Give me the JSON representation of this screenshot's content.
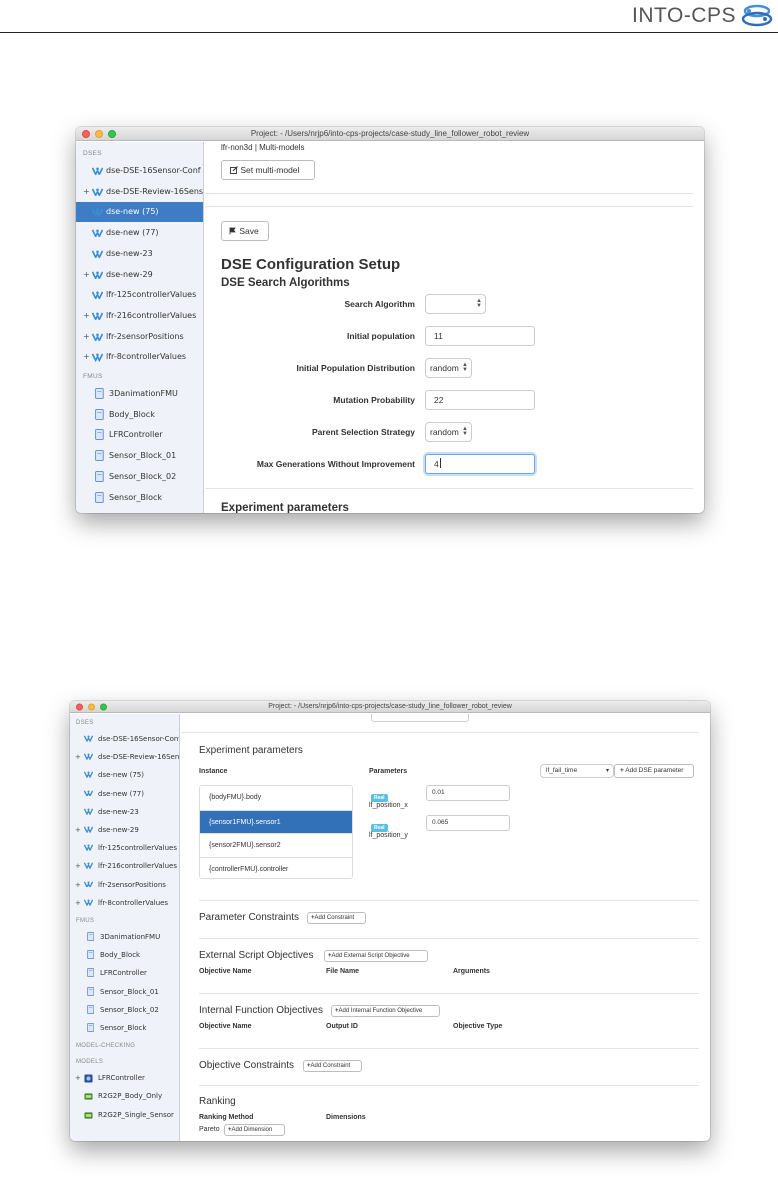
{
  "header": {
    "brand": "INTO-CPS"
  },
  "window1": {
    "title": "Project: - /Users/nrjp6/into-cps-projects/case-study_line_follower_robot_review",
    "sidebar": {
      "dses_label": "DSES",
      "dses": [
        {
          "label": "dse-DSE-16Sensor-Conf",
          "expand": ""
        },
        {
          "label": "dse-DSE-Review-16Sens",
          "expand": "+"
        },
        {
          "label": "dse-new (75)",
          "expand": "",
          "selected": true
        },
        {
          "label": "dse-new (77)",
          "expand": ""
        },
        {
          "label": "dse-new-23",
          "expand": ""
        },
        {
          "label": "dse-new-29",
          "expand": "+"
        },
        {
          "label": "lfr-125controllerValues",
          "expand": ""
        },
        {
          "label": "lfr-216controllerValues",
          "expand": "+"
        },
        {
          "label": "lfr-2sensorPositions",
          "expand": "+"
        },
        {
          "label": "lfr-8controllerValues",
          "expand": "+"
        }
      ],
      "fmus_label": "FMUS",
      "fmus": [
        "3DanimationFMU",
        "Body_Block",
        "LFRController",
        "Sensor_Block_01",
        "Sensor_Block_02",
        "Sensor_Block"
      ]
    },
    "main": {
      "breadcrumb_project": "lfr-non3d",
      "breadcrumb_sep": "|",
      "breadcrumb_section": "Multi-models",
      "set_multimodel_label": "Set multi-model",
      "save_label": "Save",
      "title": "DSE Configuration Setup",
      "subtitle": "DSE Search Algorithms",
      "rows": [
        {
          "label": "Search Algorithm",
          "kind": "select",
          "value": ""
        },
        {
          "label": "Initial population",
          "kind": "input",
          "value": "11"
        },
        {
          "label": "Initial Population Distribution",
          "kind": "select",
          "value": "random"
        },
        {
          "label": "Mutation Probability",
          "kind": "input",
          "value": "22"
        },
        {
          "label": "Parent Selection Strategy",
          "kind": "select",
          "value": "random"
        },
        {
          "label": "Max Generations Without Improvement",
          "kind": "input",
          "value": "4"
        }
      ],
      "next_section": "Experiment parameters"
    }
  },
  "window2": {
    "title": "Project: - /Users/nrjp6/into-cps-projects/case-study_line_follower_robot_review",
    "sidebar": {
      "dses_label": "DSES",
      "dses": [
        {
          "label": "dse-DSE-16Sensor-Conf",
          "expand": ""
        },
        {
          "label": "dse-DSE-Review-16Sens",
          "expand": "+"
        },
        {
          "label": "dse-new (75)",
          "expand": ""
        },
        {
          "label": "dse-new (77)",
          "expand": ""
        },
        {
          "label": "dse-new-23",
          "expand": ""
        },
        {
          "label": "dse-new-29",
          "expand": "+"
        },
        {
          "label": "lfr-125controllerValues",
          "expand": ""
        },
        {
          "label": "lfr-216controllerValues",
          "expand": "+"
        },
        {
          "label": "lfr-2sensorPositions",
          "expand": "+"
        },
        {
          "label": "lfr-8controllerValues",
          "expand": "+"
        }
      ],
      "fmus_label": "FMUS",
      "fmus": [
        "3DanimationFMU",
        "Body_Block",
        "LFRController",
        "Sensor_Block_01",
        "Sensor_Block_02",
        "Sensor_Block"
      ],
      "model_checking_label": "MODEL-CHECKING",
      "models_label": "MODELS",
      "models": [
        {
          "label": "LFRController",
          "expand": "+",
          "icon": "blue"
        },
        {
          "label": "R2G2P_Body_Only",
          "expand": "",
          "icon": "green"
        },
        {
          "label": "R2G2P_Single_Sensor",
          "expand": "",
          "icon": "green"
        }
      ]
    },
    "main": {
      "experiment_title": "Experiment parameters",
      "instance_header": "Instance",
      "parameters_header": "Parameters",
      "dse_select_value": "lf_fail_time",
      "add_dse_param_label": "Add DSE parameter",
      "instances": [
        {
          "label": "{bodyFMU}.body",
          "selected": false
        },
        {
          "label": "{sensor1FMU}.sensor1",
          "selected": true
        },
        {
          "label": "{sensor2FMU}.sensor2",
          "selected": false
        },
        {
          "label": "{controllerFMU}.controller",
          "selected": false
        }
      ],
      "params": [
        {
          "badge": "Real",
          "name": "lf_position_x",
          "value": "0.01"
        },
        {
          "badge": "Real",
          "name": "lf_position_y",
          "value": "0.065"
        }
      ],
      "param_constraints_title": "Parameter Constraints",
      "add_constraint_label": "Add Constraint",
      "ext_obj_title": "External Script Objectives",
      "add_ext_obj_label": "Add External Script Objective",
      "ext_cols": [
        "Objective Name",
        "File Name",
        "Arguments"
      ],
      "int_obj_title": "Internal Function Objectives",
      "add_int_obj_label": "Add Internal Function Objective",
      "int_cols": [
        "Objective Name",
        "Output ID",
        "Objective Type"
      ],
      "obj_constraints_title": "Objective Constraints",
      "add_obj_constraint_label": "Add Constraint",
      "ranking_title": "Ranking",
      "ranking_method_header": "Ranking Method",
      "dimensions_header": "Dimensions",
      "ranking_method_value": "Pareto",
      "add_dimension_label": "Add Dimension"
    }
  }
}
